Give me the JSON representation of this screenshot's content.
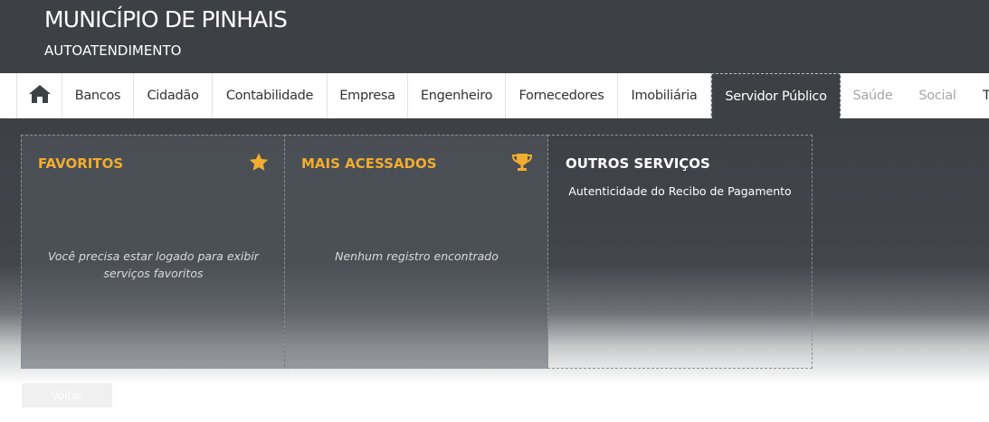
{
  "header": {
    "title": "MUNICÍPIO DE PINHAIS",
    "subtitle": "AUTOATENDIMENTO"
  },
  "nav": {
    "home_icon": "home-icon",
    "items": [
      {
        "label": "Bancos"
      },
      {
        "label": "Cidadão"
      },
      {
        "label": "Contabilidade"
      },
      {
        "label": "Empresa"
      },
      {
        "label": "Engenheiro"
      },
      {
        "label": "Fornecedores"
      },
      {
        "label": "Imobiliária"
      },
      {
        "label": "Servidor Público",
        "active": true
      },
      {
        "label": "Saúde",
        "disabled": true
      },
      {
        "label": "Social",
        "disabled": true
      },
      {
        "label": "T",
        "disabled": true
      }
    ]
  },
  "panels": {
    "favoritos": {
      "title": "FAVORITOS",
      "icon": "star-icon",
      "message": "Você precisa estar logado para exibir serviços favoritos"
    },
    "mais_acessados": {
      "title": "MAIS ACESSADOS",
      "icon": "trophy-icon",
      "message": "Nenhum registro encontrado"
    },
    "outros": {
      "title": "OUTROS SERVIÇOS",
      "link": "Autenticidade do Recibo de Pagamento"
    }
  },
  "footer": {
    "back_label": "Voltar"
  },
  "colors": {
    "header_bg": "#3d4045",
    "accent": "#f0ad2f",
    "nav_text": "#333333",
    "nav_disabled": "#a6a6a6"
  }
}
